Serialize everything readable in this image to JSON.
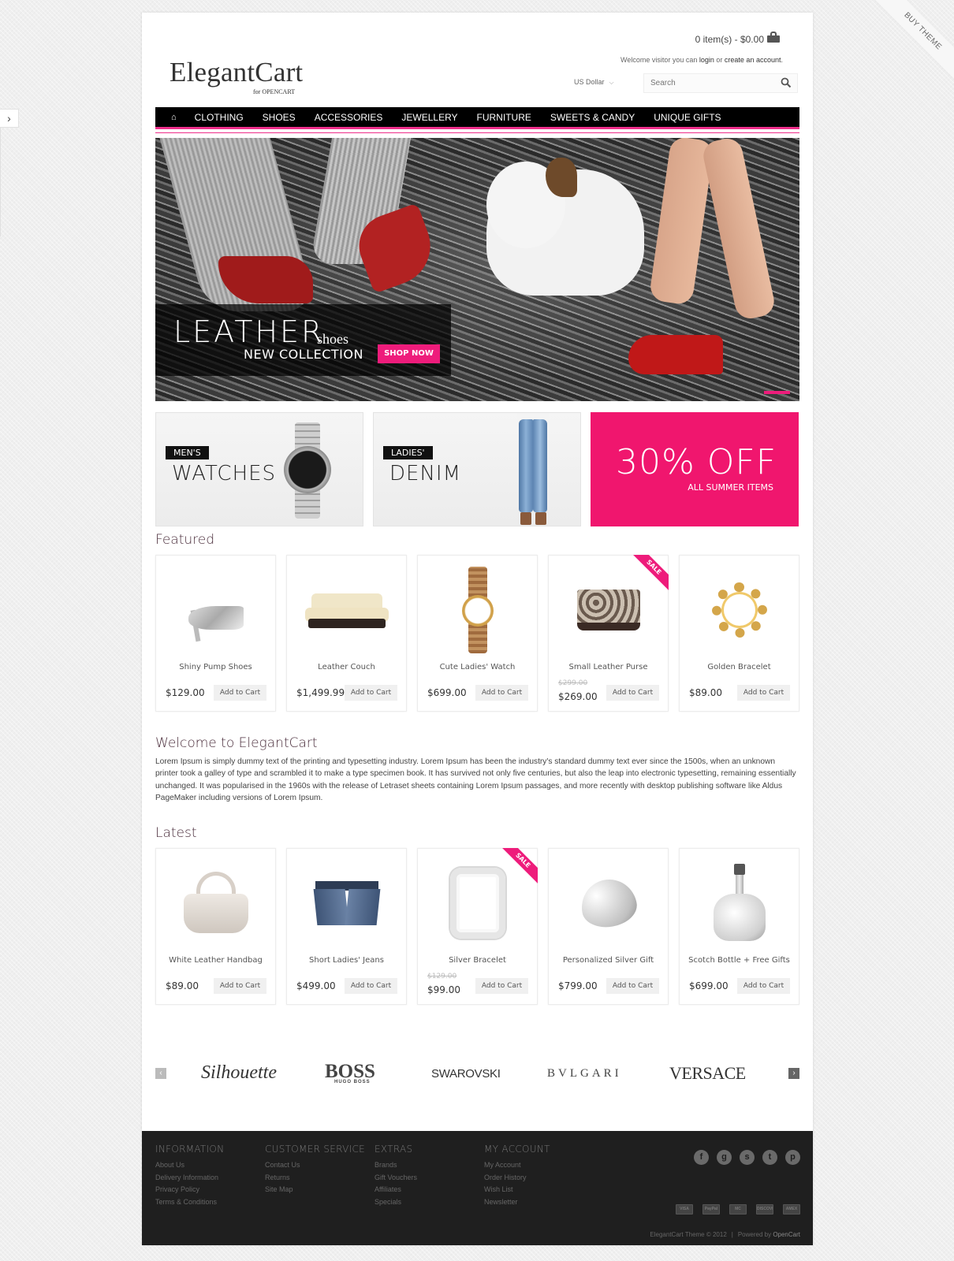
{
  "side_tab": {
    "icon": "›"
  },
  "ribbon": {
    "label": "BUY THEME"
  },
  "header": {
    "logo": {
      "main": "ElegantCart",
      "sub": "for OPENCART"
    },
    "cart_summary": "0 item(s) - $0.00",
    "welcome": {
      "prefix": "Welcome visitor you can ",
      "login": "login",
      "middle": " or ",
      "create": "create an account",
      "suffix": "."
    },
    "currency": {
      "selected": "US Dollar"
    },
    "search": {
      "placeholder": "Search",
      "value": ""
    }
  },
  "nav": {
    "home_icon": "⌂",
    "items": [
      "CLOTHING",
      "SHOES",
      "ACCESSORIES",
      "JEWELLERY",
      "FURNITURE",
      "SWEETS & CANDY",
      "UNIQUE GIFTS"
    ]
  },
  "slider": {
    "headline": "LEATHER",
    "headline_suffix": "shoes",
    "subline": "NEW COLLECTION",
    "cta": "SHOP NOW",
    "accent": "#ee1c7b"
  },
  "banners": [
    {
      "tag": "MEN'S",
      "title": "WATCHES"
    },
    {
      "tag": "LADIES'",
      "title": "DENIM"
    },
    {
      "big": "30% OFF",
      "small": "ALL SUMMER ITEMS",
      "color": "#f0166e"
    }
  ],
  "featured": {
    "title": "Featured",
    "products": [
      {
        "name": "Shiny Pump Shoes",
        "price": "$129.00",
        "old_price": null,
        "sale": false,
        "button": "Add to Cart"
      },
      {
        "name": "Leather Couch",
        "price": "$1,499.99",
        "old_price": null,
        "sale": false,
        "button": "Add to Cart"
      },
      {
        "name": "Cute Ladies' Watch",
        "price": "$699.00",
        "old_price": null,
        "sale": false,
        "button": "Add to Cart"
      },
      {
        "name": "Small Leather Purse",
        "price": "$269.00",
        "old_price": "$299.00",
        "sale": true,
        "sale_label": "SALE",
        "button": "Add to Cart"
      },
      {
        "name": "Golden Bracelet",
        "price": "$89.00",
        "old_price": null,
        "sale": false,
        "button": "Add to Cart"
      }
    ]
  },
  "welcome_section": {
    "title": "Welcome to ElegantCart",
    "text": "Lorem Ipsum is simply dummy text of the printing and typesetting industry. Lorem Ipsum has been the industry's standard dummy text ever since the 1500s, when an unknown printer took a galley of type and scrambled it to make a type specimen book. It has survived not only five centuries, but also the leap into electronic typesetting, remaining essentially unchanged. It was popularised in the 1960s with the release of Letraset sheets containing Lorem Ipsum passages, and more recently with desktop publishing software like Aldus PageMaker including versions of Lorem Ipsum."
  },
  "latest": {
    "title": "Latest",
    "products": [
      {
        "name": "White Leather Handbag",
        "price": "$89.00",
        "old_price": null,
        "sale": false,
        "button": "Add to Cart"
      },
      {
        "name": "Short Ladies' Jeans",
        "price": "$499.00",
        "old_price": null,
        "sale": false,
        "button": "Add to Cart"
      },
      {
        "name": "Silver Bracelet",
        "price": "$99.00",
        "old_price": "$129.00",
        "sale": true,
        "sale_label": "SALE",
        "button": "Add to Cart"
      },
      {
        "name": "Personalized Silver Gift",
        "price": "$799.00",
        "old_price": null,
        "sale": false,
        "button": "Add to Cart"
      },
      {
        "name": "Scotch Bottle + Free Gifts",
        "price": "$699.00",
        "old_price": null,
        "sale": false,
        "button": "Add to Cart"
      }
    ]
  },
  "brands": {
    "prev": "‹",
    "next": "›",
    "items": [
      "Silhouette",
      "BOSS",
      "SWAROVSKI",
      "BVLGARI",
      "VERSACE"
    ],
    "boss_sub": "HUGO BOSS"
  },
  "footer": {
    "columns": [
      {
        "title": "INFORMATION",
        "links": [
          "About Us",
          "Delivery Information",
          "Privacy Policy",
          "Terms & Conditions"
        ]
      },
      {
        "title": "CUSTOMER SERVICE",
        "links": [
          "Contact Us",
          "Returns",
          "Site Map"
        ]
      },
      {
        "title": "EXTRAS",
        "links": [
          "Brands",
          "Gift Vouchers",
          "Affiliates",
          "Specials"
        ]
      },
      {
        "title": "MY ACCOUNT",
        "links": [
          "My Account",
          "Order History",
          "Wish List",
          "Newsletter"
        ]
      }
    ],
    "social": [
      {
        "name": "facebook",
        "glyph": "f"
      },
      {
        "name": "google",
        "glyph": "g"
      },
      {
        "name": "skype",
        "glyph": "s"
      },
      {
        "name": "twitter",
        "glyph": "t"
      },
      {
        "name": "pinterest",
        "glyph": "p"
      }
    ],
    "payments": [
      "VISA",
      "PayPal",
      "MC",
      "DISCOVER",
      "AMEX"
    ],
    "copyright": "ElegantCart Theme © 2012",
    "separator": "|",
    "powered_prefix": "Powered by ",
    "powered_name": "OpenCart"
  }
}
